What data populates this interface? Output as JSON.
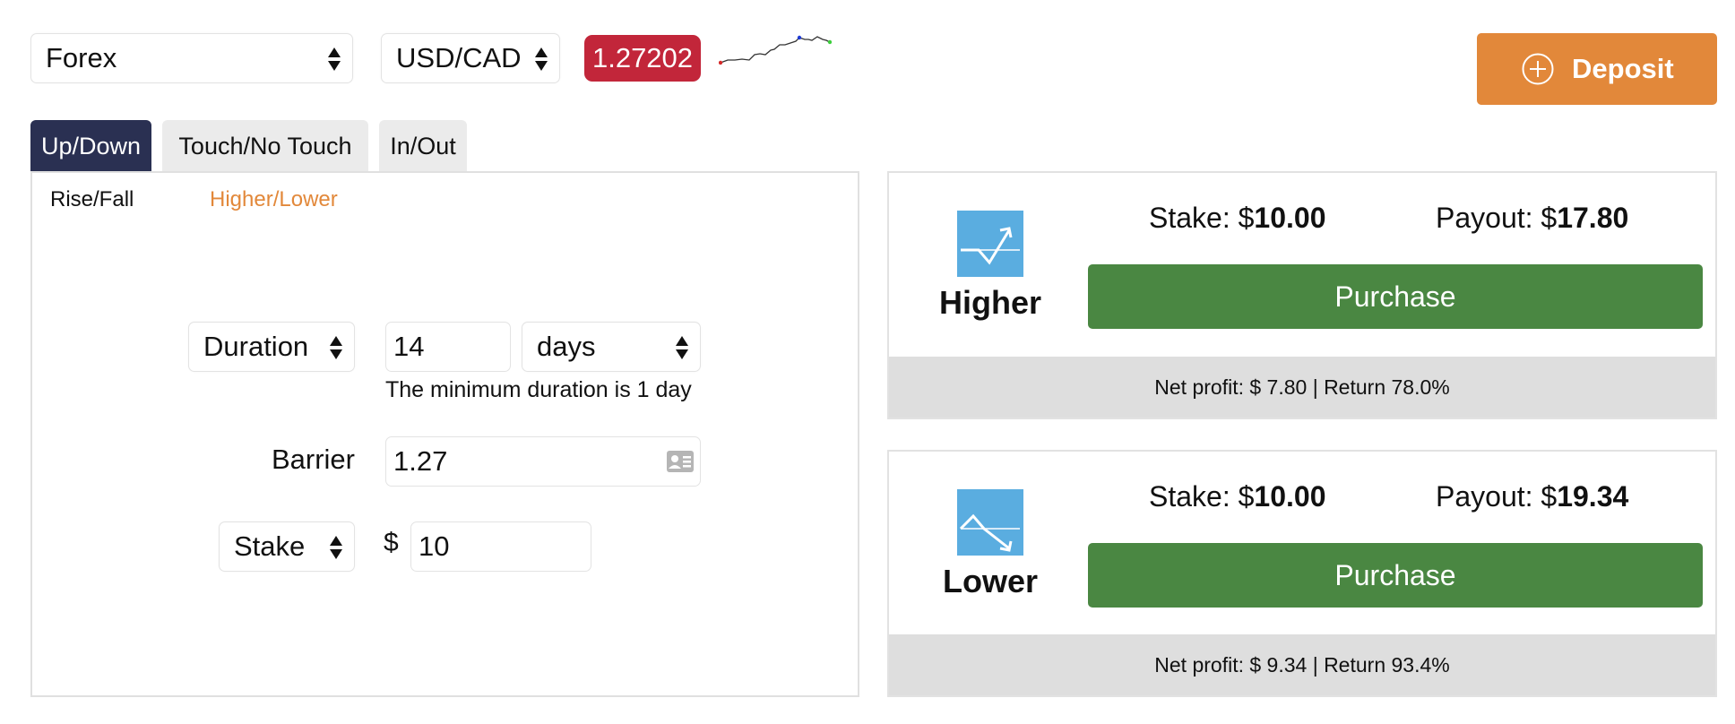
{
  "market_select": {
    "value": "Forex"
  },
  "symbol_select": {
    "value": "USD/CAD"
  },
  "spot_price": "1.27202",
  "deposit_button": {
    "label": "Deposit"
  },
  "tabs": [
    {
      "label": "Up/Down",
      "active": true
    },
    {
      "label": "Touch/No Touch",
      "active": false
    },
    {
      "label": "In/Out",
      "active": false
    }
  ],
  "subtabs": [
    {
      "label": "Rise/Fall",
      "active": false
    },
    {
      "label": "Higher/Lower",
      "active": true
    }
  ],
  "form": {
    "duration_select": "Duration",
    "duration_value": "14",
    "duration_unit": "days",
    "duration_hint": "The minimum duration is 1 day",
    "barrier_label": "Barrier",
    "barrier_value": "1.27",
    "stake_select": "Stake",
    "currency_symbol": "$",
    "stake_value": "10"
  },
  "contracts": [
    {
      "direction": "Higher",
      "stake_label": "Stake:",
      "stake_currency": "$",
      "stake_amount": "10.00",
      "payout_label": "Payout:",
      "payout_currency": "$",
      "payout_amount": "17.80",
      "purchase_label": "Purchase",
      "footer": "Net profit: $ 7.80 | Return 78.0%"
    },
    {
      "direction": "Lower",
      "stake_label": "Stake:",
      "stake_currency": "$",
      "stake_amount": "10.00",
      "payout_label": "Payout:",
      "payout_currency": "$",
      "payout_amount": "19.34",
      "purchase_label": "Purchase",
      "footer": "Net profit: $ 9.34 | Return 93.4%"
    }
  ],
  "colors": {
    "price_badge": "#c2263a",
    "deposit": "#e2883a",
    "tab_active": "#2a3052",
    "subtab_active": "#e2883a",
    "purchase": "#4a8742",
    "direction_icon": "#5aade0",
    "footer": "#dedede"
  },
  "icons": {
    "select_arrows": "sort-arrows-icon",
    "deposit": "plus-circle-icon",
    "barrier": "id-card-icon",
    "higher": "trend-up-icon",
    "lower": "trend-down-icon",
    "sparkline": "price-sparkline"
  }
}
